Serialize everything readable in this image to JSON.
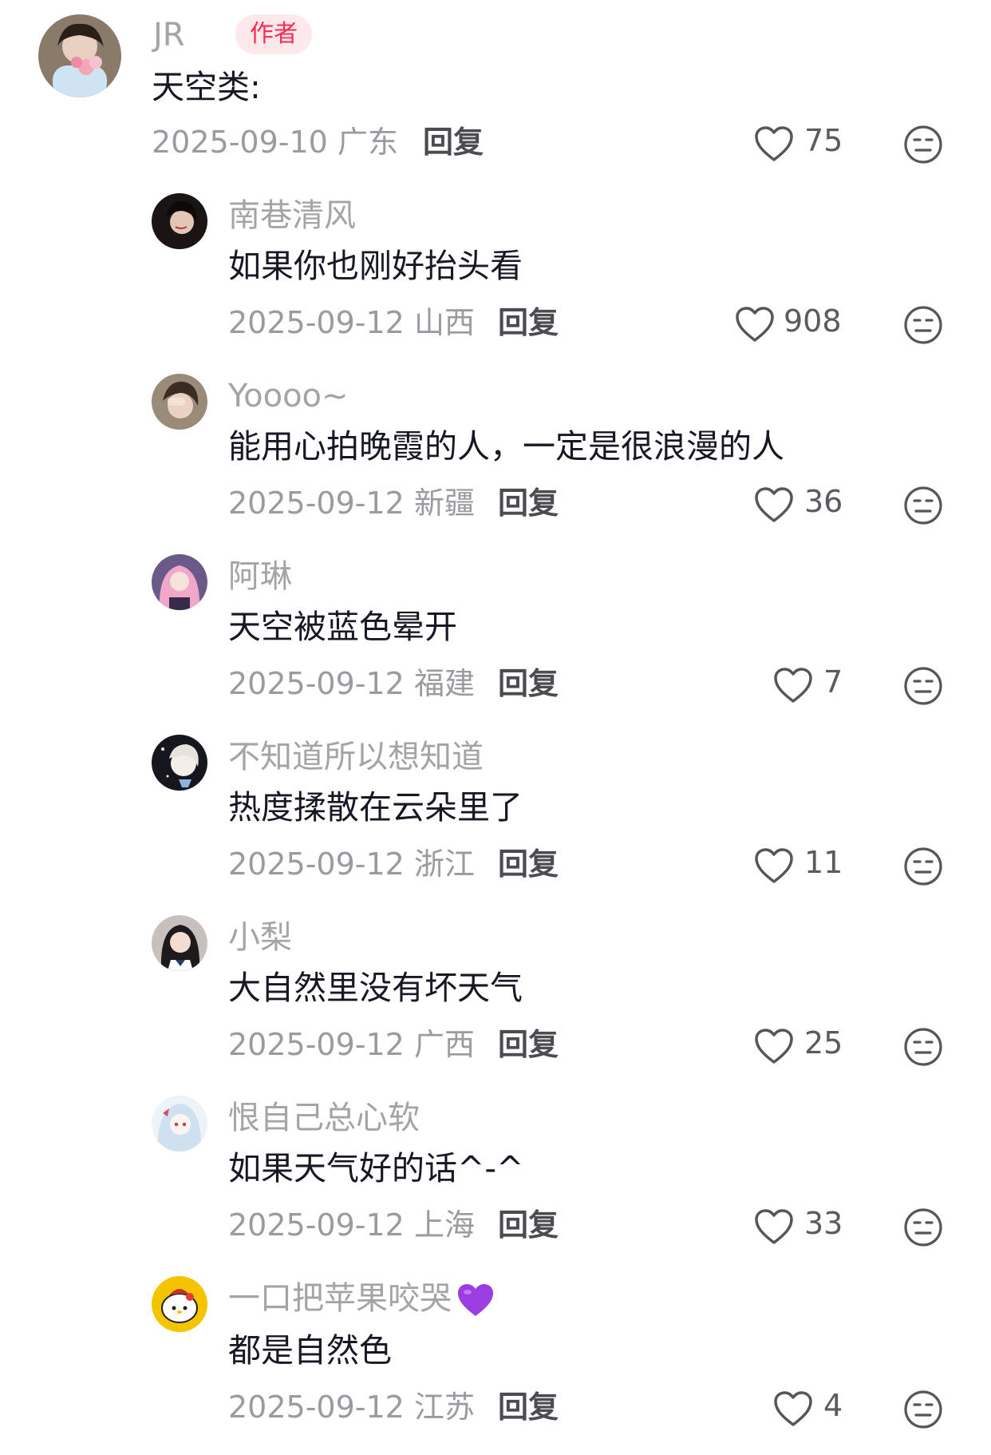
{
  "top_comment": {
    "username": "JR",
    "badge": "作者",
    "text": "天空类:",
    "date": "2025-09-10",
    "location": "广东",
    "reply_label": "回复",
    "likes": "75"
  },
  "replies": [
    {
      "username": "南巷清风",
      "text": "如果你也刚好抬头看",
      "date": "2025-09-12",
      "location": "山西",
      "reply_label": "回复",
      "likes": "908",
      "avatar_color": "#3a2a2a"
    },
    {
      "username": "Yoooo~",
      "text": "能用心拍晚霞的人，一定是很浪漫的人",
      "date": "2025-09-12",
      "location": "新疆",
      "reply_label": "回复",
      "likes": "36",
      "avatar_color": "#6b5a4a"
    },
    {
      "username": "阿琳",
      "text": "天空被蓝色晕开",
      "date": "2025-09-12",
      "location": "福建",
      "reply_label": "回复",
      "likes": "7",
      "avatar_color": "#c9a3c9"
    },
    {
      "username": "不知道所以想知道",
      "text": "热度揉散在云朵里了",
      "date": "2025-09-12",
      "location": "浙江",
      "reply_label": "回复",
      "likes": "11",
      "avatar_color": "#1c1c24"
    },
    {
      "username": "小梨",
      "text": "大自然里没有坏天气",
      "date": "2025-09-12",
      "location": "广西",
      "reply_label": "回复",
      "likes": "25",
      "avatar_color": "#2e2a30"
    },
    {
      "username": "恨自己总心软",
      "text": "如果天气好的话^-^",
      "date": "2025-09-12",
      "location": "上海",
      "reply_label": "回复",
      "likes": "33",
      "avatar_color": "#dfe8f2"
    },
    {
      "username": "一口把苹果咬哭",
      "username_emoji": "purple-heart",
      "text": "都是自然色",
      "date": "2025-09-12",
      "location": "江苏",
      "reply_label": "回复",
      "likes": "4",
      "avatar_color": "#f2c200"
    }
  ],
  "colors": {
    "author_badge_bg": "#fde8ec",
    "author_badge_text": "#fe2c55",
    "username": "#a3a3a8",
    "text": "#161823",
    "meta": "#9a9aa0",
    "emoji_heart": "#9b3de0"
  },
  "icons": {
    "like": "heart-outline-icon",
    "dislike": "neutral-face-icon"
  }
}
